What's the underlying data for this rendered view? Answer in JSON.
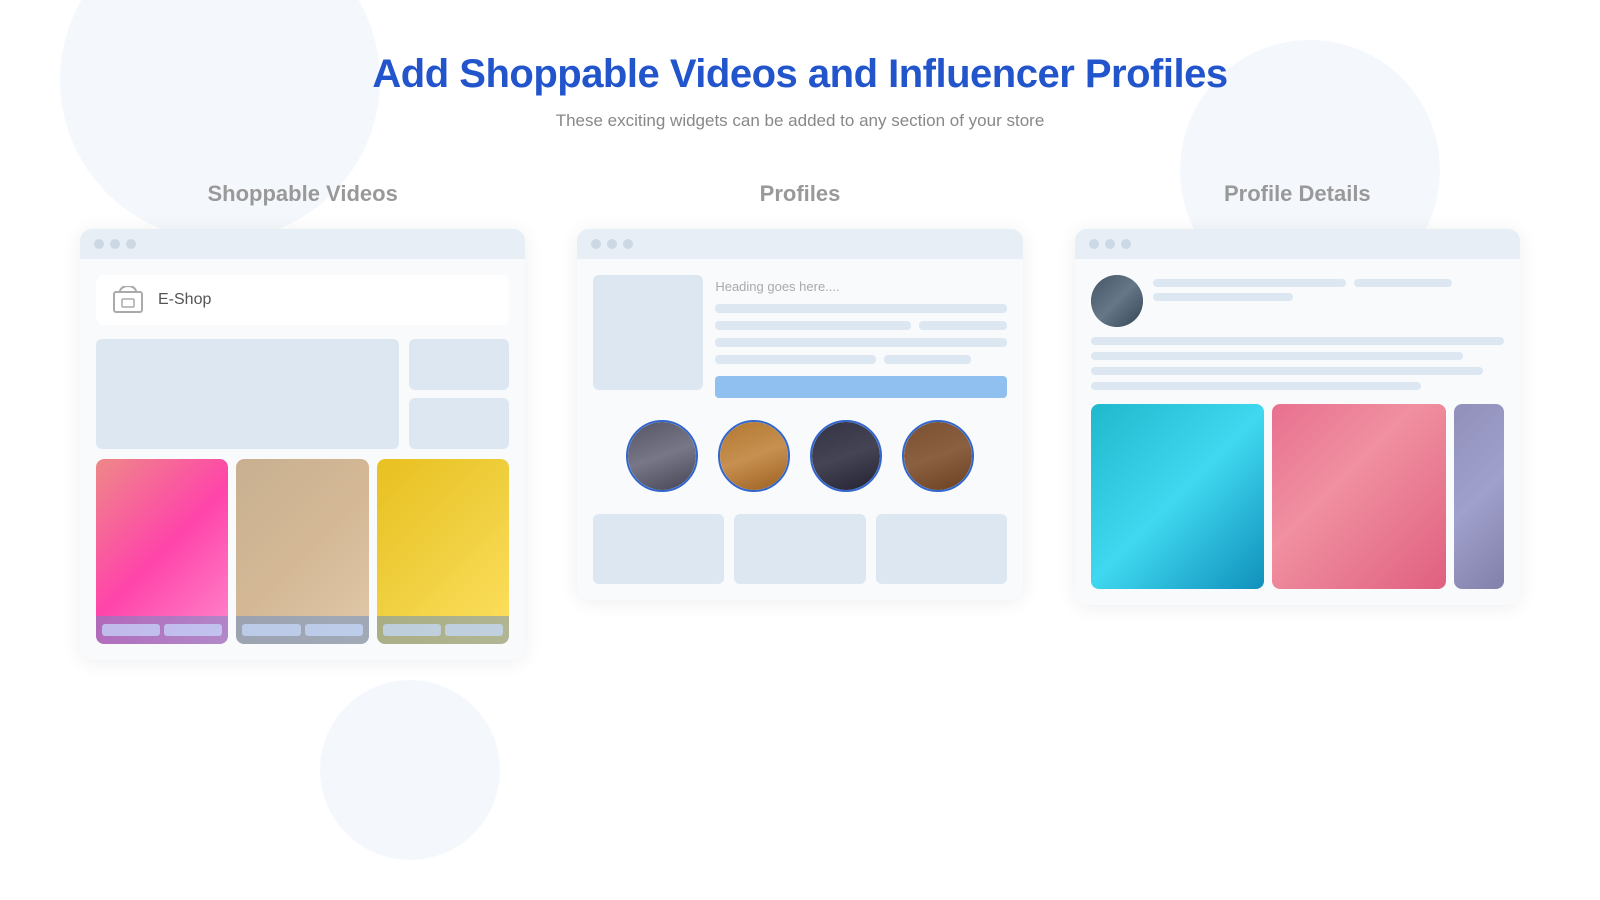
{
  "header": {
    "title": "Add Shoppable Videos and Influencer Profiles",
    "subtitle": "These exciting widgets can be added to any section of your store"
  },
  "cards": {
    "shoppable_videos": {
      "label": "Shoppable Videos",
      "shop_name": "E-Shop",
      "dots": [
        "dot1",
        "dot2",
        "dot3"
      ]
    },
    "profiles": {
      "label": "Profiles",
      "heading_placeholder": "Heading goes here....",
      "dots": [
        "dot1",
        "dot2",
        "dot3"
      ]
    },
    "profile_details": {
      "label": "Profile Details",
      "dots": [
        "dot1",
        "dot2",
        "dot3"
      ]
    }
  }
}
